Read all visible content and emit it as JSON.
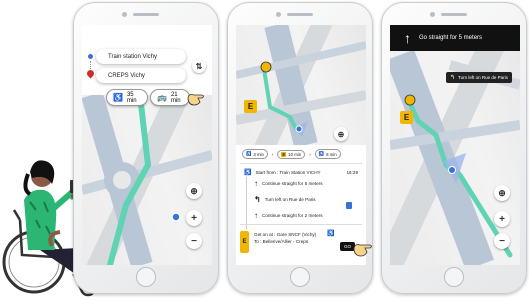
{
  "screen1": {
    "origin": "Train station Vichy",
    "destination": "CREPS Vichy",
    "walk_time": "35 min",
    "bus_time": "21 min",
    "swap_icon": "swap-vertical-icon",
    "zoom_in": "+",
    "zoom_out": "−"
  },
  "screen2": {
    "marker": "E",
    "summary": {
      "walk1": "3 min",
      "bus": "10 min",
      "walk2": "8 min",
      "bus_letter": "E"
    },
    "start_label": "Start from : Train Station VICHY",
    "start_time": "16:29",
    "steps": [
      "Continue straight for 5 meters",
      "Turn left on Rue de Paris",
      "Continue straight for 2 meters"
    ],
    "getin_line1": "Get on at : Gare SNCF (Vichy)",
    "getin_line2": "To : Bellerive/Allier - Creps",
    "go_label": "GO"
  },
  "screen3": {
    "instruction": "Go straight for 5 meters",
    "next_instruction": "Turn left on Rue de Paris",
    "marker": "E",
    "zoom_in": "+",
    "zoom_out": "−"
  },
  "colors": {
    "route": "#5fd3b4",
    "bus_yellow": "#f2b600",
    "road_blue": "#b8c6d6",
    "dark_bar": "#111111"
  }
}
